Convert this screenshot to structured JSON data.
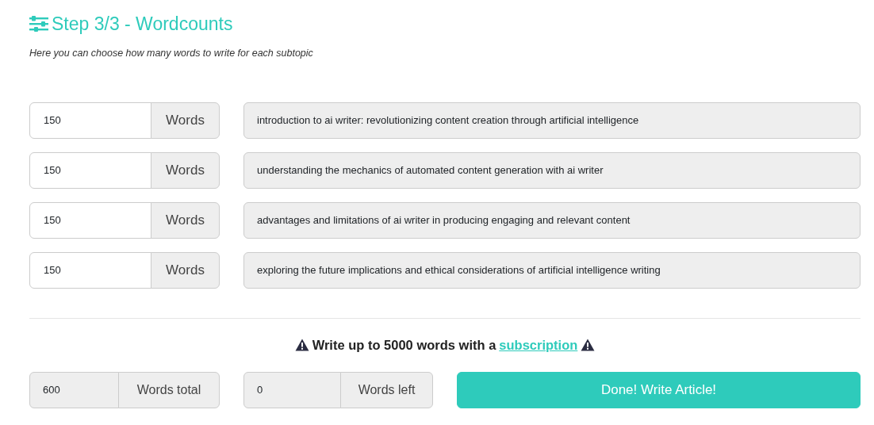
{
  "heading": {
    "title": "Step 3/3 - Wordcounts",
    "subtitle": "Here you can choose how many words to write for each subtopic"
  },
  "subtopics": [
    {
      "words": "150",
      "unit": "Words",
      "topic": "introduction to ai writer: revolutionizing content creation through artificial intelligence",
      "readonly": true
    },
    {
      "words": "150",
      "unit": "Words",
      "topic": "understanding the mechanics of automated content generation with ai writer",
      "readonly": true
    },
    {
      "words": "150",
      "unit": "Words",
      "topic": "advantages and limitations of ai writer in producing engaging and relevant content",
      "readonly": true
    },
    {
      "words": "150",
      "unit": "Words",
      "topic": "exploring the future implications and ethical considerations of artificial intelligence writing",
      "readonly": true
    }
  ],
  "notice": {
    "text": "Write up to 5000 words with a",
    "link": "subscription"
  },
  "totals": [
    {
      "value": "600",
      "unit": "Words total",
      "readonly": true
    },
    {
      "value": "0",
      "unit": "Words left",
      "readonly": true
    }
  ],
  "submit_button": "Done! Write Article!"
}
